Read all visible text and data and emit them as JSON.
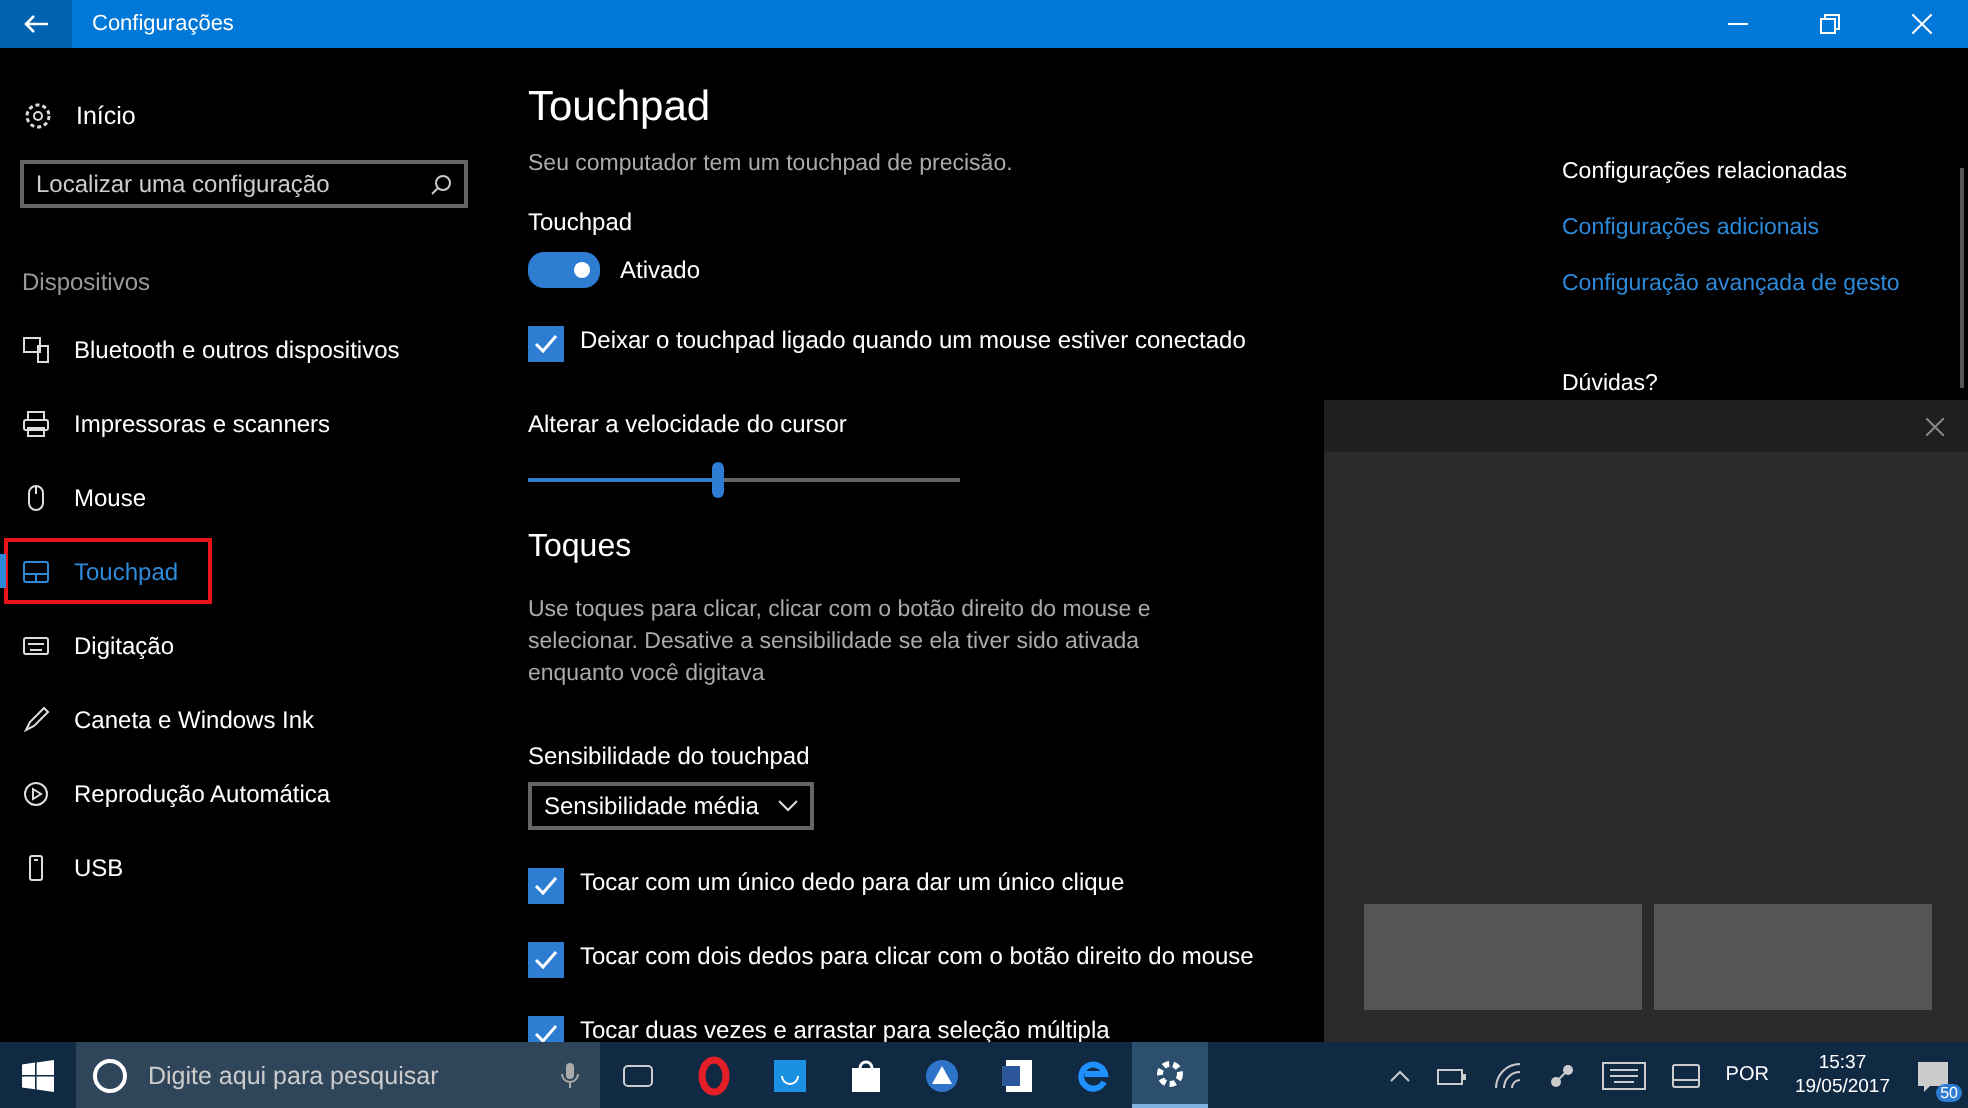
{
  "window": {
    "title": "Configurações"
  },
  "sidebar": {
    "home": "Início",
    "search": {
      "placeholder": "Localizar uma configuração"
    },
    "section": "Dispositivos",
    "items": [
      {
        "label": "Bluetooth e outros dispositivos",
        "selected": false,
        "highlighted": false
      },
      {
        "label": "Impressoras e scanners",
        "selected": false,
        "highlighted": false
      },
      {
        "label": "Mouse",
        "selected": false,
        "highlighted": false
      },
      {
        "label": "Touchpad",
        "selected": true,
        "highlighted": true
      },
      {
        "label": "Digitação",
        "selected": false,
        "highlighted": false
      },
      {
        "label": "Caneta e Windows Ink",
        "selected": false,
        "highlighted": false
      },
      {
        "label": "Reprodução Automática",
        "selected": false,
        "highlighted": false
      },
      {
        "label": "USB",
        "selected": false,
        "highlighted": false
      }
    ]
  },
  "content": {
    "title": "Touchpad",
    "description": "Seu computador tem um touchpad de precisão.",
    "touchpad_label": "Touchpad",
    "toggle": {
      "on": true,
      "label": "Ativado"
    },
    "keep_on": {
      "checked": true,
      "label": "Deixar o touchpad ligado quando um mouse estiver conectado"
    },
    "speed": {
      "label": "Alterar a velocidade do cursor",
      "level": 0.44
    },
    "taps": {
      "heading": "Toques",
      "description": "Use toques para clicar, clicar com o botão direito do mouse e selecionar. Desative a sensibilidade se ela tiver sido ativada enquanto você digitava",
      "sensitivity_label": "Sensibilidade do touchpad",
      "sensitivity_value": "Sensibilidade média",
      "options": [
        {
          "label": "Tocar com um único dedo para dar um único clique",
          "checked": true
        },
        {
          "label": "Tocar com dois dedos para clicar com o botão direito do mouse",
          "checked": true
        },
        {
          "label": "Tocar duas vezes e arrastar para seleção múltipla",
          "checked": true
        }
      ]
    }
  },
  "related": {
    "heading": "Configurações relacionadas",
    "links": [
      "Configurações adicionais",
      "Configuração avançada de gesto"
    ],
    "help_heading": "Dúvidas?"
  },
  "taskbar": {
    "search_placeholder": "Digite aqui para pesquisar",
    "apps": [
      {
        "selected": false
      },
      {
        "selected": false
      },
      {
        "selected": false
      },
      {
        "selected": false
      },
      {
        "selected": false
      },
      {
        "selected": false
      },
      {
        "selected": false
      },
      {
        "selected": true
      }
    ],
    "language": "POR",
    "time": "15:37",
    "date": "19/05/2017",
    "notification_count": "50"
  }
}
